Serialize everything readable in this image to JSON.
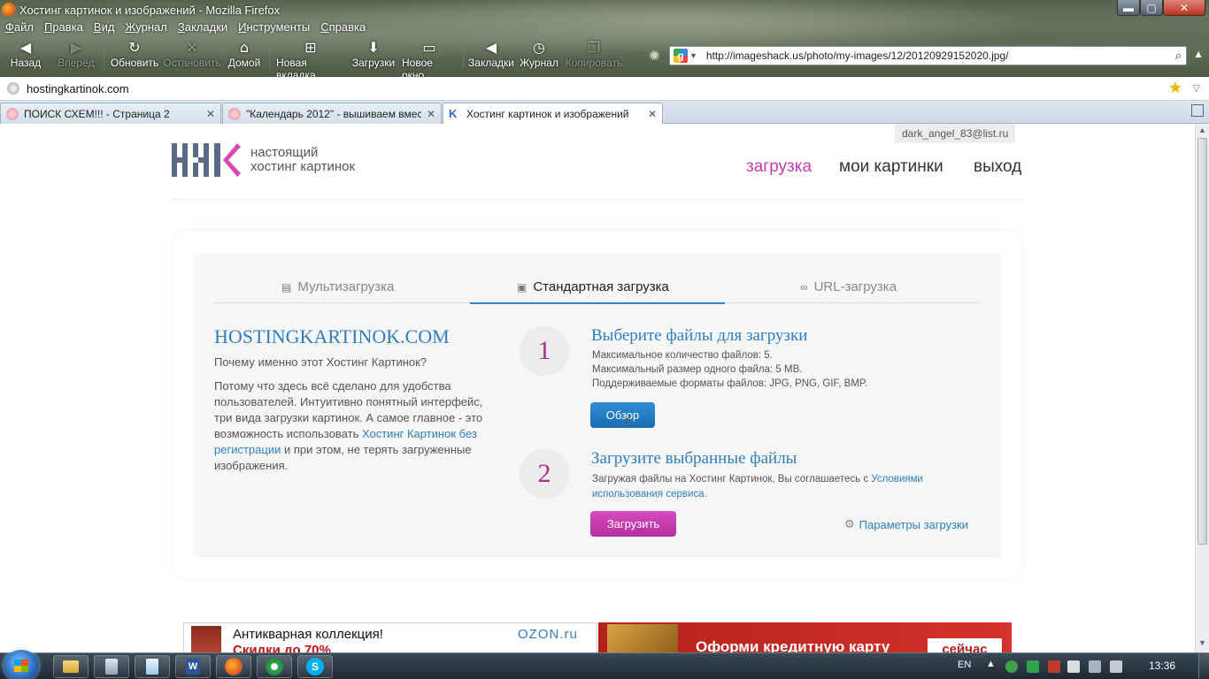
{
  "window": {
    "title": "Хостинг картинок и изображений - Mozilla Firefox",
    "minimize_glyph": "▬",
    "maximize_glyph": "▢",
    "close_glyph": "✕"
  },
  "menu": [
    "Файл",
    "Правка",
    "Вид",
    "Журнал",
    "Закладки",
    "Инструменты",
    "Справка"
  ],
  "toolbar": {
    "back": "Назад",
    "forward": "Вперёд",
    "reload": "Обновить",
    "stop": "Остановить",
    "home": "Домой",
    "new_tab": "Новая вкладка",
    "downloads": "Загрузки",
    "new_window": "Новое окно",
    "bookmarks": "Закладки",
    "history": "Журнал",
    "copy": "Копировать",
    "url": "http://imageshack.us/photo/my-images/12/20120929152020.jpg/",
    "url_engine_glyph": "g"
  },
  "address": {
    "text": "hostingkartinok.com"
  },
  "tabs": [
    {
      "label": "ПОИСК СХЕМ!!! - Страница 2",
      "active": false
    },
    {
      "label": "\"Календарь 2012\" - вышиваем вмес...",
      "active": false
    },
    {
      "label": "Хостинг картинок и изображений",
      "active": true
    }
  ],
  "page": {
    "user_email": "dark_angel_83@list.ru",
    "logo_line1": "настоящий",
    "logo_line2": "хостинг картинок",
    "nav": {
      "upload": "загрузка",
      "my_pictures": "мои картинки",
      "logout": "выход"
    },
    "upload_tabs": {
      "multi": "Мультизагрузка",
      "standard": "Стандартная загрузка",
      "url": "URL-загрузка"
    },
    "intro": {
      "heading": "HOSTINGKARTINOK.COM",
      "question": "Почему именно этот Хостинг Картинок?",
      "desc_part1": "Потому что здесь всё сделано для удобства пользователей. Интуитивно понятный интерфейс, три вида загрузки картинок. А самое главное - это возможность использовать ",
      "desc_link": "Хостинг Картинок без регистрации",
      "desc_part2": " и при этом, не терять загруженные изображения."
    },
    "step1": {
      "number": "1",
      "title": "Выберите файлы для загрузки",
      "max_count": "Максимальное количество файлов: 5.",
      "max_size": "Максимальный размер одного файла: 5 MB.",
      "formats": "Поддерживаемые форматы файлов: JPG, PNG, GIF, BMP.",
      "browse_label": "Обзор"
    },
    "step2": {
      "number": "2",
      "title": "Загрузите выбранные файлы",
      "terms_part1": "Загружая файлы на Хостинг Картинок, Вы соглашаетесь с ",
      "terms_link": "Условиями использования сервиса",
      "terms_part2": ".",
      "submit_label": "Загрузить",
      "params_label": "Параметры загрузки"
    },
    "ads": {
      "left_title": "Антикварная коллекция!",
      "left_sub": "Скидки до 70%",
      "left_brand": "OZON.ru",
      "right_text": "Оформи кредитную карту",
      "right_button": "сейчас"
    }
  },
  "taskbar": {
    "lang": "EN",
    "clock": "13:36",
    "word_letter": "W",
    "skype_letter": "S"
  },
  "colors": {
    "accent_blue": "#2f7fc0",
    "accent_pink": "#c93cac",
    "browse_button": "#1a6db2",
    "upload_button": "#b42e9e"
  }
}
